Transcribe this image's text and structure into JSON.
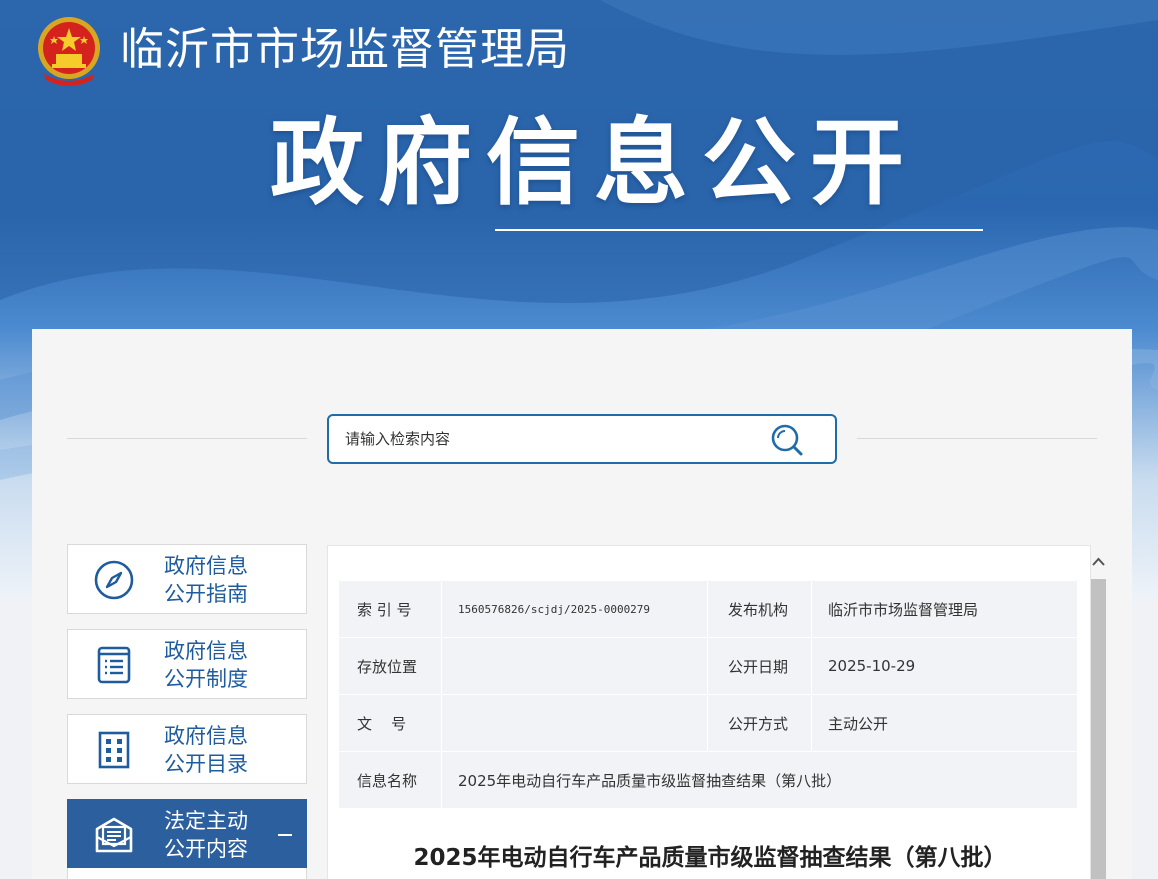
{
  "header": {
    "agency_name": "临沂市市场监督管理局",
    "section_title": "政府信息公开",
    "emblem_icon": "national-emblem-icon"
  },
  "search": {
    "placeholder": "请输入检索内容",
    "button_icon": "search-icon"
  },
  "sidebar": {
    "items": [
      {
        "label": "政府信息\n公开指南",
        "icon": "compass-icon",
        "active": false
      },
      {
        "label": "政府信息\n公开制度",
        "icon": "document-list-icon",
        "active": false
      },
      {
        "label": "政府信息\n公开目录",
        "icon": "catalog-grid-icon",
        "active": false
      },
      {
        "label": "法定主动\n公开内容",
        "icon": "newspaper-icon",
        "active": true
      }
    ]
  },
  "meta": {
    "index_no_label": "索 引 号",
    "index_no_value": "1560576826/scjdj/2025-0000279",
    "publisher_label": "发布机构",
    "publisher_value": "临沂市市场监督管理局",
    "location_label": "存放位置",
    "location_value": "",
    "date_label": "公开日期",
    "date_value": "2025-10-29",
    "doc_no_label": "文    号",
    "doc_no_value": "",
    "method_label": "公开方式",
    "method_value": "主动公开",
    "name_label": "信息名称",
    "name_value": "2025年电动自行车产品质量市级监督抽查结果（第八批）"
  },
  "article": {
    "title": "2025年电动自行车产品质量市级监督抽查结果（第八批）"
  },
  "colors": {
    "banner_blue": "#2f6cb3",
    "accent_blue": "#1f5c9e",
    "active_blue": "#2c5f9e",
    "search_border": "#1f6ca8"
  }
}
